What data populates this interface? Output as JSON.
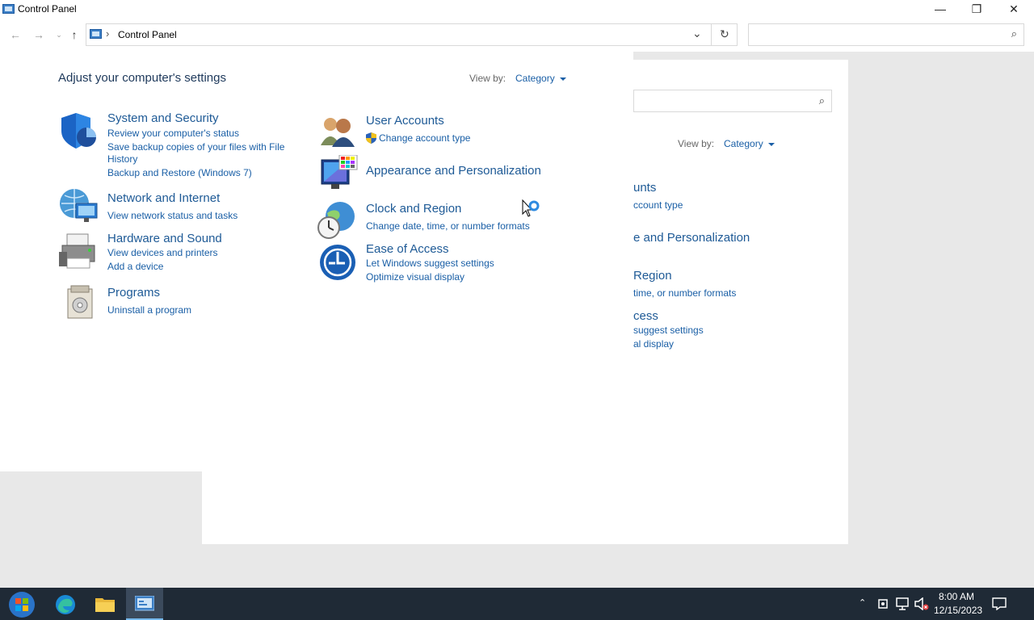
{
  "window": {
    "title": "Control Panel",
    "minimize_glyph": "—",
    "restore_glyph": "❐",
    "close_glyph": "✕"
  },
  "address": {
    "back_glyph": "←",
    "forward_glyph": "→",
    "up_glyph": "↑",
    "crumb_sep": "›",
    "crumb": "Control Panel",
    "dropdown_glyph": "⌄",
    "refresh_glyph": "↻",
    "search_placeholder": ""
  },
  "main": {
    "heading": "Adjust your computer's settings",
    "view_by_label": "View by:",
    "view_by_value": "Category",
    "categories": [
      {
        "title": "System and Security",
        "icon": "shield-icon",
        "links": [
          "Review your computer's status",
          "Save backup copies of your files with File",
          "History",
          "Backup and Restore (Windows 7)"
        ]
      },
      {
        "title": "Network and Internet",
        "icon": "network-globe-icon",
        "links": [
          "View network status and tasks"
        ]
      },
      {
        "title": "Hardware and Sound",
        "icon": "printer-icon",
        "links": [
          "View devices and printers",
          "Add a device"
        ]
      },
      {
        "title": "Programs",
        "icon": "programs-box-icon",
        "links": [
          "Uninstall a program"
        ]
      },
      {
        "title": "User Accounts",
        "icon": "users-icon",
        "links": [
          "Change account type"
        ]
      },
      {
        "title": "Appearance and Personalization",
        "icon": "monitor-palette-icon",
        "links": []
      },
      {
        "title": "Clock and Region",
        "icon": "clock-globe-icon",
        "links": [
          "Change date, time, or number formats"
        ]
      },
      {
        "title": "Ease of Access",
        "icon": "ease-of-access-icon",
        "links": [
          "Let Windows suggest settings",
          "Optimize visual display"
        ]
      }
    ]
  },
  "ghost": {
    "view_by_label": "View by:",
    "view_by_value": "Category",
    "lines": [
      "unts",
      "ccount type",
      "e and Personalization",
      "Region",
      "time, or number formats",
      "cess",
      "suggest settings",
      "al display"
    ]
  },
  "taskbar": {
    "time": "8:00 AM",
    "date": "12/15/2023",
    "colors": {
      "bg": "#1f2a36",
      "accent": "#0078d7"
    }
  }
}
